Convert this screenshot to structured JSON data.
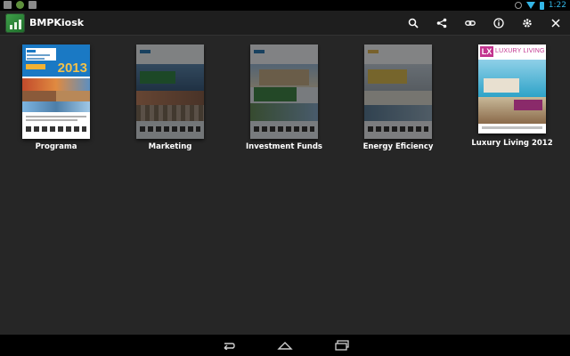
{
  "status_bar": {
    "time": "1:22",
    "left_icons": [
      "image-icon",
      "android-icon",
      "photo-icon"
    ],
    "right_icons": [
      "alarm-icon",
      "wifi-icon",
      "battery-icon"
    ]
  },
  "action_bar": {
    "title": "BMPKiosk",
    "actions": [
      "search-icon",
      "share-icon",
      "link-icon",
      "info-icon",
      "settings-icon",
      "close-icon"
    ]
  },
  "publications": [
    {
      "title": "Programa",
      "highlight": "2013"
    },
    {
      "title": "Marketing"
    },
    {
      "title": "Investment Funds"
    },
    {
      "title": "Energy Eficiency"
    },
    {
      "title": "Luxury Living 2012",
      "brand_prefix": "LX",
      "brand_name": "LUXURY LIVING"
    }
  ],
  "nav_bar": {
    "buttons": [
      "back-icon",
      "home-icon",
      "recent-apps-icon"
    ]
  },
  "colors": {
    "background": "#262626",
    "action_bar": "#1e1e1e",
    "accent": "#33b5e5"
  }
}
